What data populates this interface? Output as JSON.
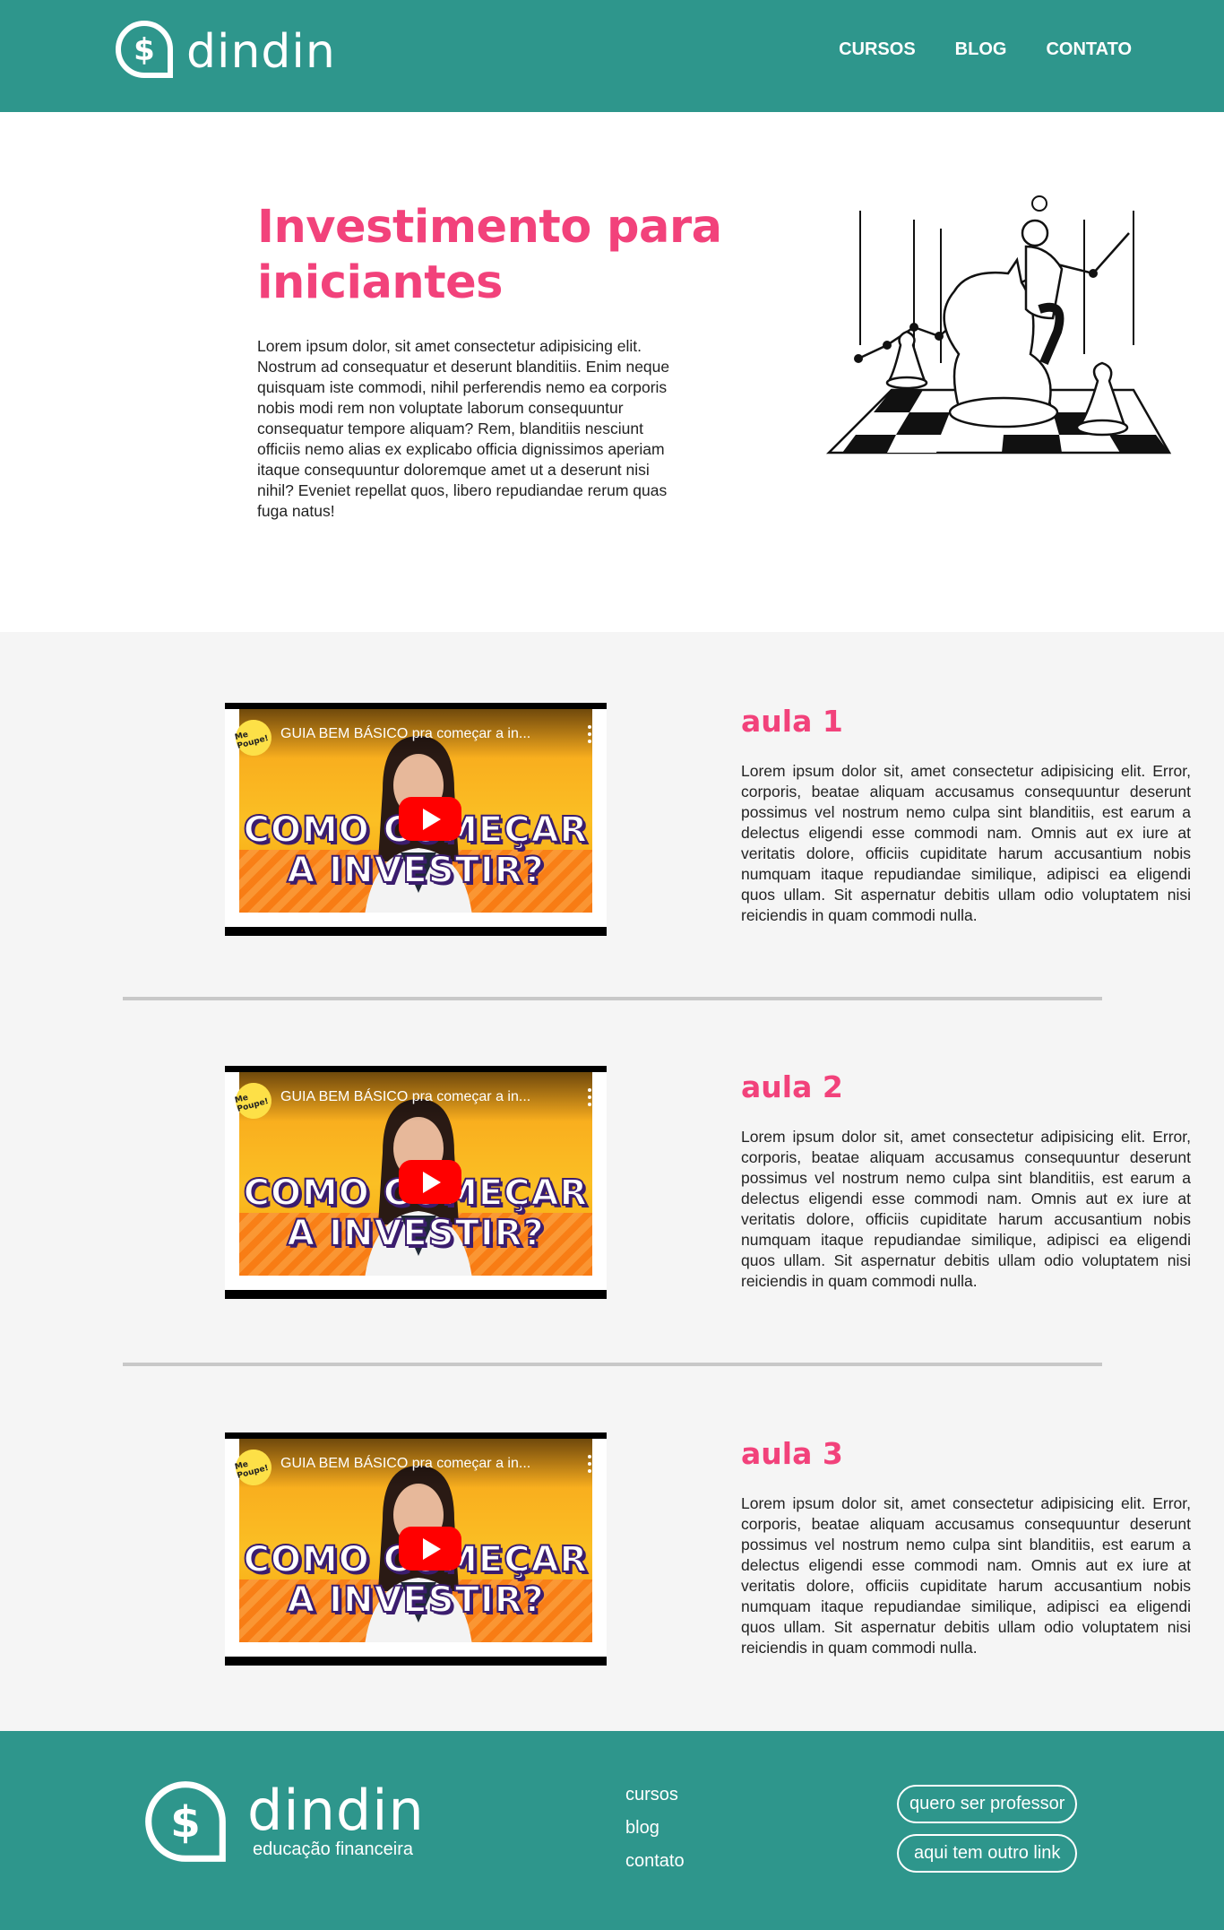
{
  "header": {
    "logo_text": "dindin",
    "nav": [
      "CURSOS",
      "BLOG",
      "CONTATO"
    ]
  },
  "hero": {
    "title": "Investimento para iniciantes",
    "text": "Lorem ipsum dolor, sit amet consectetur adipisicing elit. Nostrum ad consequatur et deserunt blanditiis. Enim neque quisquam iste commodi, nihil perferendis nemo ea corporis nobis modi rem non voluptate laborum consequuntur consequatur tempore aliquam? Rem, blanditiis nesciunt officiis nemo alias ex explicabo officia dignissimos aperiam itaque consequuntur doloremque amet ut a deserunt nisi nihil? Eveniet repellat quos, libero repudiandae rerum quas fuga natus!"
  },
  "video": {
    "title": "GUIA BEM BÁSICO pra começar a in...",
    "channel": "Me Poupe!",
    "thumb_line1": "COMO COMEÇAR",
    "thumb_line2": "A INVESTIR?"
  },
  "lessons": [
    {
      "title": "aula 1",
      "text": "Lorem ipsum dolor sit, amet consectetur adipisicing elit. Error, corporis, beatae aliquam accusamus consequuntur deserunt possimus vel nostrum nemo culpa sint blanditiis, est earum a delectus eligendi esse commodi nam. Omnis aut ex iure at veritatis dolore, officiis cupiditate harum accusantium nobis numquam itaque repudiandae similique, adipisci ea eligendi quos ullam. Sit aspernatur debitis ullam odio voluptatem nisi reiciendis in quam commodi nulla."
    },
    {
      "title": "aula 2",
      "text": "Lorem ipsum dolor sit, amet consectetur adipisicing elit. Error, corporis, beatae aliquam accusamus consequuntur deserunt possimus vel nostrum nemo culpa sint blanditiis, est earum a delectus eligendi esse commodi nam. Omnis aut ex iure at veritatis dolore, officiis cupiditate harum accusantium nobis numquam itaque repudiandae similique, adipisci ea eligendi quos ullam. Sit aspernatur debitis ullam odio voluptatem nisi reiciendis in quam commodi nulla."
    },
    {
      "title": "aula 3",
      "text": "Lorem ipsum dolor sit, amet consectetur adipisicing elit. Error, corporis, beatae aliquam accusamus consequuntur deserunt possimus vel nostrum nemo culpa sint blanditiis, est earum a delectus eligendi esse commodi nam. Omnis aut ex iure at veritatis dolore, officiis cupiditate harum accusantium nobis numquam itaque repudiandae similique, adipisci ea eligendi quos ullam. Sit aspernatur debitis ullam odio voluptatem nisi reiciendis in quam commodi nulla."
    }
  ],
  "footer": {
    "logo_text": "dindin",
    "logo_sub": "educação financeira",
    "links": [
      "cursos",
      "blog",
      "contato"
    ],
    "buttons": [
      "quero ser professor",
      "aqui tem outro link"
    ]
  },
  "colors": {
    "brand_teal": "#2e968c",
    "accent_pink": "#f2427b",
    "section_gray": "#f5f5f5"
  },
  "icons": [
    "dollar-speech-bubble-icon",
    "youtube-play-icon",
    "more-vertical-icon"
  ]
}
